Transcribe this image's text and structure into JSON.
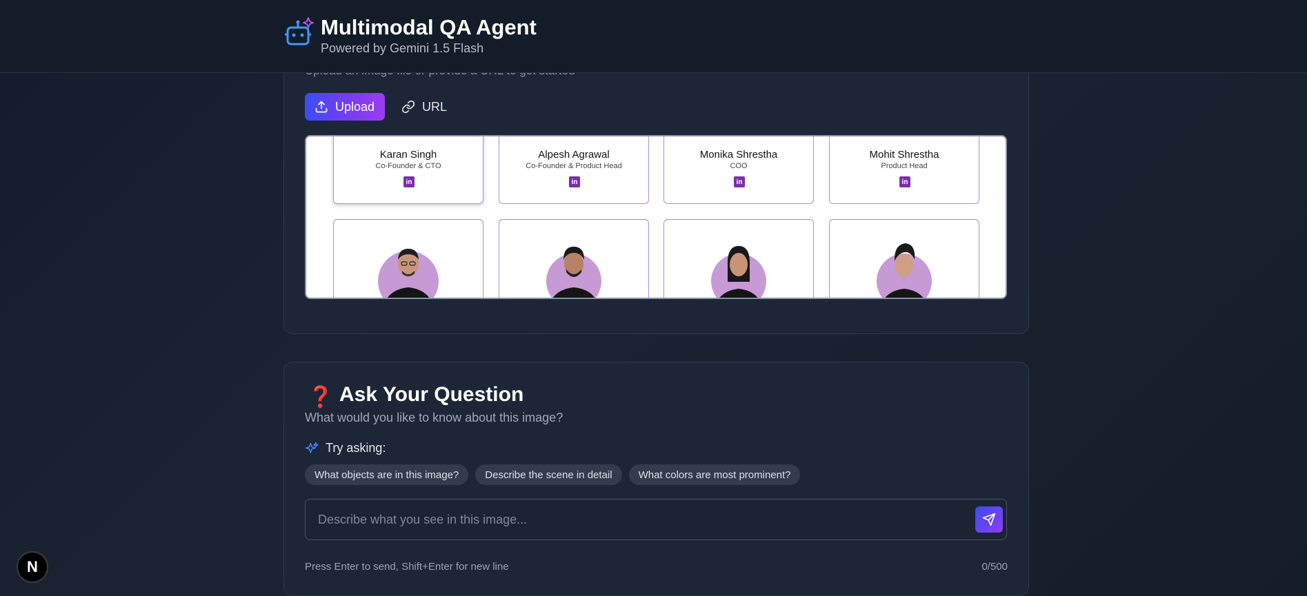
{
  "header": {
    "title": "Multimodal QA Agent",
    "subtitle": "Powered by Gemini 1.5 Flash",
    "icon": "robot-sparkle-icon"
  },
  "upload": {
    "hint": "Upload an image file or provide a URL to get started",
    "tabs": [
      {
        "label": "Upload",
        "icon": "upload-icon",
        "active": true
      },
      {
        "label": "URL",
        "icon": "link-icon",
        "active": false
      }
    ],
    "preview": {
      "people": [
        {
          "name": "Karan Singh",
          "role": "Co-Founder & CTO",
          "badge": "in"
        },
        {
          "name": "Alpesh Agrawal",
          "role": "Co-Founder & Product Head",
          "badge": "in"
        },
        {
          "name": "Monika Shrestha",
          "role": "COO",
          "badge": "in"
        },
        {
          "name": "Mohit Shrestha",
          "role": "Product Head",
          "badge": "in"
        }
      ]
    }
  },
  "question": {
    "icon": "❓",
    "title": "Ask Your Question",
    "subtitle": "What would you like to know about this image?",
    "try_label": "Try asking:",
    "suggestions": [
      "What objects are in this image?",
      "Describe the scene in detail",
      "What colors are most prominent?"
    ],
    "input_placeholder": "Describe what you see in this image...",
    "input_value": "",
    "hint": "Press Enter to send, Shift+Enter for new line",
    "counter": "0/500"
  },
  "badge": "N",
  "colors": {
    "accent_start": "#3b4cf5",
    "accent_end": "#9b3df0",
    "background": "#1b2433",
    "card": "#1d2636"
  }
}
